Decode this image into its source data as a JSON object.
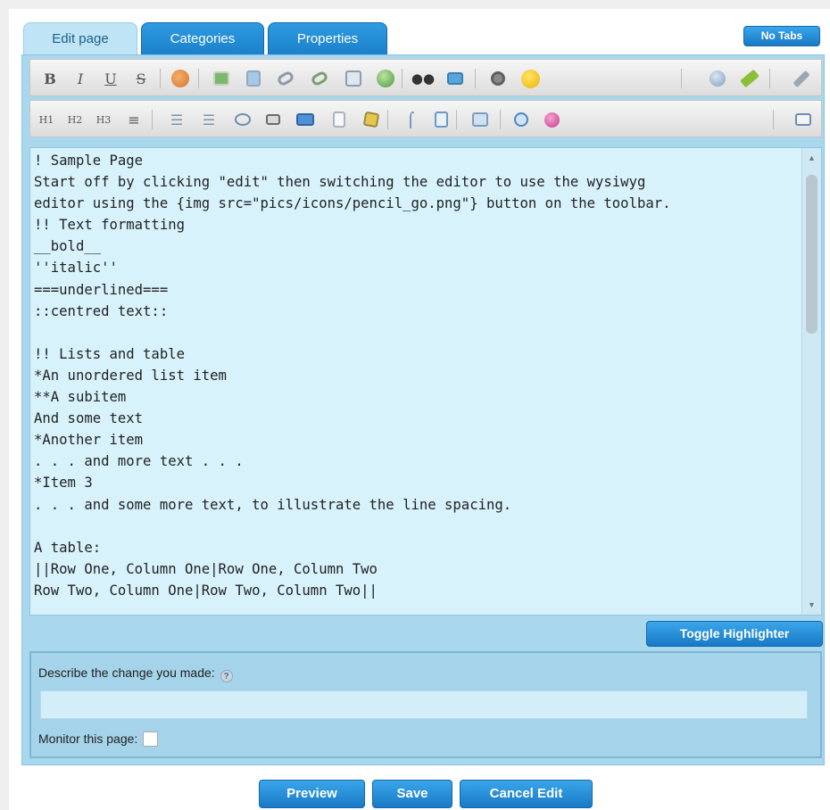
{
  "tabs": [
    {
      "label": "Edit page",
      "active": true
    },
    {
      "label": "Categories",
      "active": false
    },
    {
      "label": "Properties",
      "active": false
    }
  ],
  "no_tabs_label": "No Tabs",
  "toolbar1": {
    "bold": "B",
    "italic": "I",
    "underline": "U",
    "strike": "S",
    "icons": [
      "color-icon",
      "image-icon",
      "paste-icon",
      "link-icon",
      "unlink-icon",
      "save-icon",
      "globe-icon",
      "find-icon",
      "replace-icon",
      "spellcheck-icon",
      "smiley-icon",
      "help-icon",
      "edit-wysiwyg-icon",
      "settings-icon"
    ]
  },
  "toolbar2": {
    "h1": "H1",
    "h2": "H2",
    "h3": "H3",
    "icons": [
      "align-center-icon",
      "bullet-list-icon",
      "number-list-icon",
      "comment-icon",
      "table-icon",
      "box-icon",
      "page-icon",
      "note-icon",
      "hr-icon",
      "page-break-icon",
      "template-icon",
      "code-icon",
      "special-char-icon",
      "fullscreen-icon"
    ]
  },
  "editor": {
    "content": "! Sample Page\nStart off by clicking \"edit\" then switching the editor to use the wysiwyg\neditor using the {img src=\"pics/icons/pencil_go.png\"} button on the toolbar.\n!! Text formatting\n__bold__\n''italic''\n===underlined===\n::centred text::\n\n!! Lists and table\n*An unordered list item\n**A subitem\nAnd some text\n*Another item\n. . . and more text . . .\n*Item 3\n. . . and some more text, to illustrate the line spacing.\n\nA table:\n||Row One, Column One|Row One, Column Two\nRow Two, Column One|Row Two, Column Two||"
  },
  "toggle_highlighter_label": "Toggle Highlighter",
  "describe_label": "Describe the change you made:",
  "describe_value": "",
  "monitor_label": "Monitor this page:",
  "monitor_checked": false,
  "buttons": {
    "preview": "Preview",
    "save": "Save",
    "cancel": "Cancel Edit"
  }
}
